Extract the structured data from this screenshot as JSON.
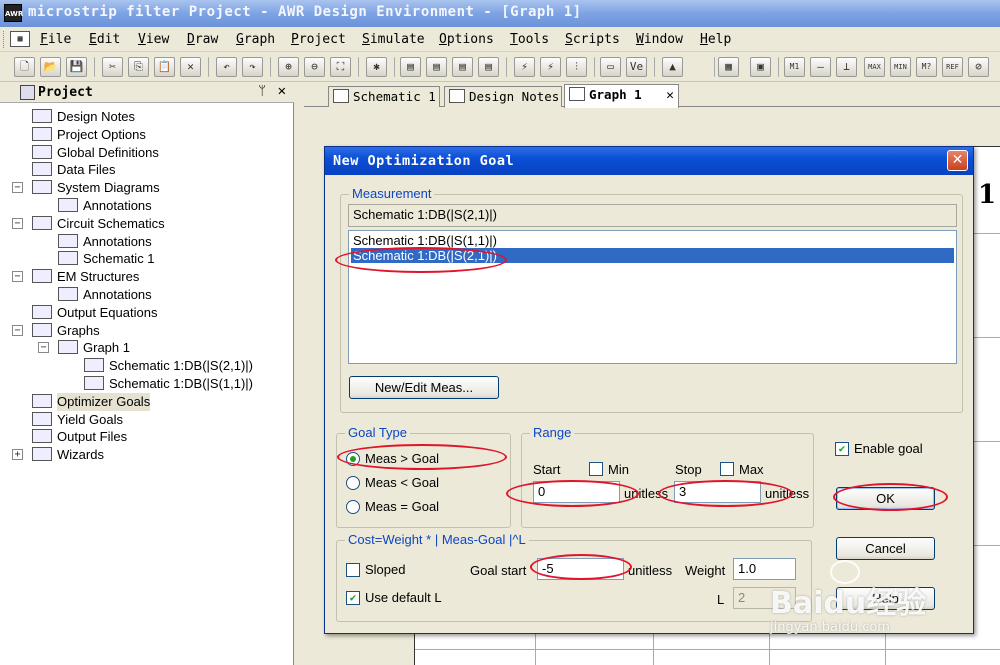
{
  "window": {
    "app_icon": "AWR",
    "title": "microstrip filter Project - AWR Design Environment - [Graph 1]"
  },
  "menubar": {
    "items": [
      "File",
      "Edit",
      "View",
      "Draw",
      "Graph",
      "Project",
      "Simulate",
      "Options",
      "Tools",
      "Scripts",
      "Window",
      "Help"
    ]
  },
  "toolbar": {
    "icons": [
      "new-icon",
      "open-icon",
      "save-icon",
      "cut-icon",
      "copy-icon",
      "paste-icon",
      "delete-icon",
      "undo-icon",
      "redo-icon",
      "zoom-in-icon",
      "zoom-out-icon",
      "zoom-fit-icon",
      "new-graph-icon",
      "add-meas-icon",
      "simulate-icon",
      "tune-icon",
      "tune-tool-icon",
      "optimize-icon",
      "yield-icon",
      "var-icon",
      "marker-icon",
      "settings-icon",
      "add-marker-icon",
      "marker-m1-icon",
      "marker-line-icon",
      "marker-max-icon",
      "marker-min-icon",
      "marker-search-icon",
      "marker-ref-icon",
      "marker-off-icon"
    ]
  },
  "project_panel": {
    "title": "Project",
    "pin": "ᛘ",
    "close": "✕",
    "items": [
      {
        "label": "Design Notes",
        "icon": "notes-icon",
        "level": 1
      },
      {
        "label": "Project Options",
        "icon": "options-icon",
        "level": 1
      },
      {
        "label": "Global Definitions",
        "icon": "global-defs-icon",
        "level": 1
      },
      {
        "label": "Data Files",
        "icon": "folder-icon",
        "level": 1
      },
      {
        "label": "System Diagrams",
        "icon": "system-diagram-icon",
        "level": 1,
        "expander": "−"
      },
      {
        "label": "Annotations",
        "icon": "annotation-icon",
        "level": 2
      },
      {
        "label": "Circuit Schematics",
        "icon": "schematic-icon",
        "level": 1,
        "expander": "−"
      },
      {
        "label": "Annotations",
        "icon": "annotation-icon",
        "level": 2
      },
      {
        "label": "Schematic 1",
        "icon": "schematic-doc-icon",
        "level": 2
      },
      {
        "label": "EM Structures",
        "icon": "em-icon",
        "level": 1,
        "expander": "−"
      },
      {
        "label": "Annotations",
        "icon": "annotation-icon",
        "level": 2
      },
      {
        "label": "Output Equations",
        "icon": "equations-icon",
        "level": 1
      },
      {
        "label": "Graphs",
        "icon": "graphs-icon",
        "level": 1,
        "expander": "−"
      },
      {
        "label": "Graph 1",
        "icon": "graph-icon",
        "level": 2,
        "expander": "−"
      },
      {
        "label": "Schematic 1:DB(|S(2,1)|)",
        "icon": "measurement-icon",
        "level": 3
      },
      {
        "label": "Schematic 1:DB(|S(1,1)|)",
        "icon": "measurement-icon",
        "level": 3
      },
      {
        "label": "Optimizer Goals",
        "icon": "optimizer-goals-icon",
        "level": 1,
        "selected": true
      },
      {
        "label": "Yield Goals",
        "icon": "yield-goals-icon",
        "level": 1
      },
      {
        "label": "Output Files",
        "icon": "output-files-icon",
        "level": 1
      },
      {
        "label": "Wizards",
        "icon": "wizards-icon",
        "level": 1,
        "expander": "+"
      }
    ]
  },
  "tabs": [
    {
      "label": "Schematic 1",
      "icon": "schematic-tab-icon"
    },
    {
      "label": "Design Notes",
      "icon": "notes-tab-icon"
    },
    {
      "label": "Graph 1",
      "icon": "graph-tab-icon",
      "active": true,
      "close": "✕"
    }
  ],
  "graph": {
    "partial_title": "1"
  },
  "dialog": {
    "title": "New Optimization Goal",
    "close": "✕",
    "measurement": {
      "legend": "Measurement",
      "selected_value": "Schematic 1:DB(|S(2,1)|)",
      "list": [
        "Schematic 1:DB(|S(1,1)|)",
        "Schematic 1:DB(|S(2,1)|)"
      ],
      "selected_index": 1,
      "new_edit_button": "New/Edit Meas..."
    },
    "goal_type": {
      "legend": "Goal Type",
      "options": [
        "Meas > Goal",
        "Meas < Goal",
        "Meas = Goal"
      ],
      "selected_index": 0
    },
    "range": {
      "legend": "Range",
      "start_label": "Start",
      "min_label": "Min",
      "min_checked": false,
      "stop_label": "Stop",
      "max_label": "Max",
      "max_checked": false,
      "start_value": "0",
      "start_unit": "unitless",
      "stop_value": "3",
      "stop_unit": "unitless"
    },
    "enable_goal": {
      "label": "Enable goal",
      "checked": true
    },
    "ok_button": "OK",
    "cancel_button": "Cancel",
    "help_button": "Help",
    "cost": {
      "legend": "Cost=Weight * | Meas-Goal |^L",
      "sloped_label": "Sloped",
      "sloped_checked": false,
      "goal_start_label": "Goal start",
      "goal_start_value": "-5",
      "goal_start_unit": "unitless",
      "weight_label": "Weight",
      "weight_value": "1.0",
      "use_default_l_label": "Use default L",
      "use_default_l_checked": true,
      "l_label": "L",
      "l_value": "2"
    }
  },
  "watermark": {
    "text": "Baidu经验",
    "url_text": "jingyan.baidu.com"
  },
  "colors": {
    "title_blue": "#0a4fd6",
    "selection": "#316ac5",
    "annotation_red": "#e0142a",
    "xp_face": "#ece9d8",
    "group_legend": "#0b46c4"
  }
}
